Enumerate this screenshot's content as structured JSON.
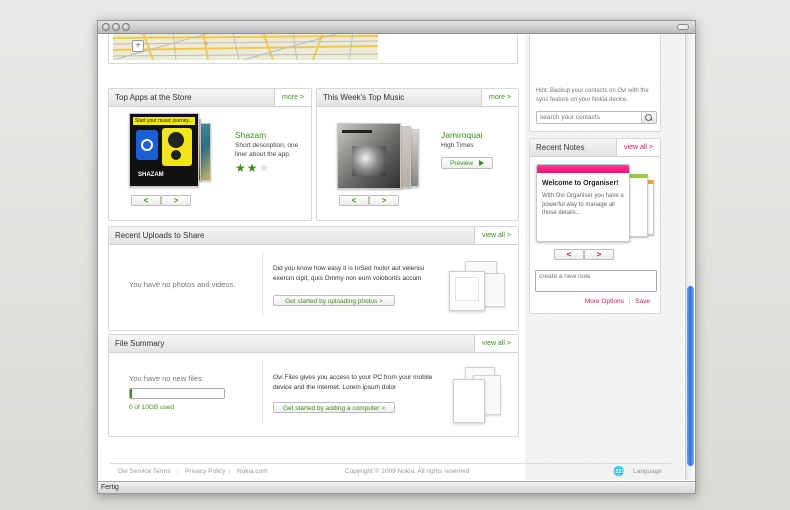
{
  "browser": {
    "status_text": "Fertig"
  },
  "top_apps": {
    "title": "Top Apps at the Store",
    "more": "more >",
    "app_name": "Shazam",
    "description": "Short description, one liner about the app.",
    "rating": 2,
    "rating_max": 3,
    "screen_text": "Start your music journey...",
    "brand_text": "SHAZAM",
    "prev": "<",
    "next": ">"
  },
  "top_music": {
    "title": "This Week's Top Music",
    "more": "more >",
    "artist": "Jamiroquai",
    "album": "High Times",
    "preview_label": "Preview",
    "prev": "<",
    "next": ">"
  },
  "recent_uploads": {
    "title": "Recent Uploads to Share",
    "view_all": "view all >",
    "empty_text": "You have no photos and videos.",
    "info_text": "Did you know how easy it is toSed molor aut velenisi exercin cipit, quis Ommy non eum volobortis accum",
    "cta": "Get started by uploading photos >"
  },
  "file_summary": {
    "title": "File Summary",
    "view_all": "view all >",
    "empty_text": "You have no new files",
    "usage_text": "0 of 10GB used",
    "usage_fraction": 0.02,
    "info_text": "Ovi Files gives you access to your PC from your mobile device and the internet. Lorem ipsum dolor",
    "cta": "Get started by adding a computer >"
  },
  "contacts": {
    "hint": "Hint: Backup your contacts on Ovi with the sync feature on your Nokia device.",
    "search_placeholder": "search your contacts"
  },
  "recent_notes": {
    "title": "Recent Notes",
    "view_all": "view all >",
    "note_title": "Welcome to Organiser!",
    "note_body": "With Ovi Organiser you have a powerful way to manage all those details...",
    "prev": "<",
    "next": ">",
    "new_note_placeholder": "create a new note",
    "more_options": "More Options",
    "separator": "|",
    "save": "Save"
  },
  "footer": {
    "links": [
      "Ovi Service Terms",
      "Privacy Policy",
      "Nokia.com"
    ],
    "separator": "|",
    "copyright": "Copyright © 2009 Nokia. All rights reserved",
    "language": "Language"
  },
  "colors": {
    "accent_green": "#3e8e1c",
    "accent_pink": "#d0145a",
    "scroll_blue": "#2f6fd8"
  }
}
